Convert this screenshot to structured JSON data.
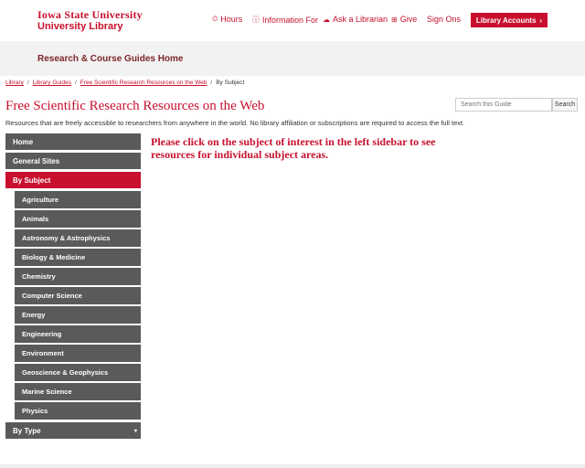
{
  "header": {
    "university": "Iowa State University",
    "library": "University Library",
    "nav": [
      {
        "icon": "clock-icon",
        "glyph": "⏲",
        "label": "Hours"
      },
      {
        "icon": "info-icon",
        "glyph": "ⓘ",
        "label": "Information For"
      },
      {
        "icon": "chat-icon",
        "glyph": "☁",
        "label": "Ask a Librarian"
      },
      {
        "icon": "gift-icon",
        "glyph": "⊞",
        "label": "Give"
      },
      {
        "label": "Sign Ons"
      }
    ],
    "accounts_label": "Library Accounts",
    "accounts_chevron": "›"
  },
  "band": {
    "title": "Research & Course Guides Home"
  },
  "breadcrumb": {
    "items": [
      "Library",
      "Library Guides",
      "Free Scientific Research Resources on the Web"
    ],
    "current": "By Subject",
    "separator": "/"
  },
  "page": {
    "title": "Free Scientific Research Resources on the Web",
    "description": "Resources that are freely accessible to researchers from anywhere in the world. No library affiliation or subscriptions are required to access the full text."
  },
  "search": {
    "placeholder": "Search this Guide",
    "button": "Search"
  },
  "sidebar": {
    "top": [
      "Home",
      "General Sites",
      "By Subject"
    ],
    "subjects": [
      "Agriculture",
      "Animals",
      "Astronomy & Astrophysics",
      "Biology & Medicine",
      "Chemistry",
      "Computer Science",
      "Energy",
      "Engineering",
      "Environment",
      "Geoscience & Geophysics",
      "Marine Science",
      "Physics"
    ],
    "bottom": "By Type",
    "bottom_caret": "▾"
  },
  "main": {
    "message": "Please click on the subject of interest in the left sidebar to see resources for individual subject areas."
  },
  "colors": {
    "brand": "#c8102e",
    "sidebar": "#5a5a5a"
  }
}
